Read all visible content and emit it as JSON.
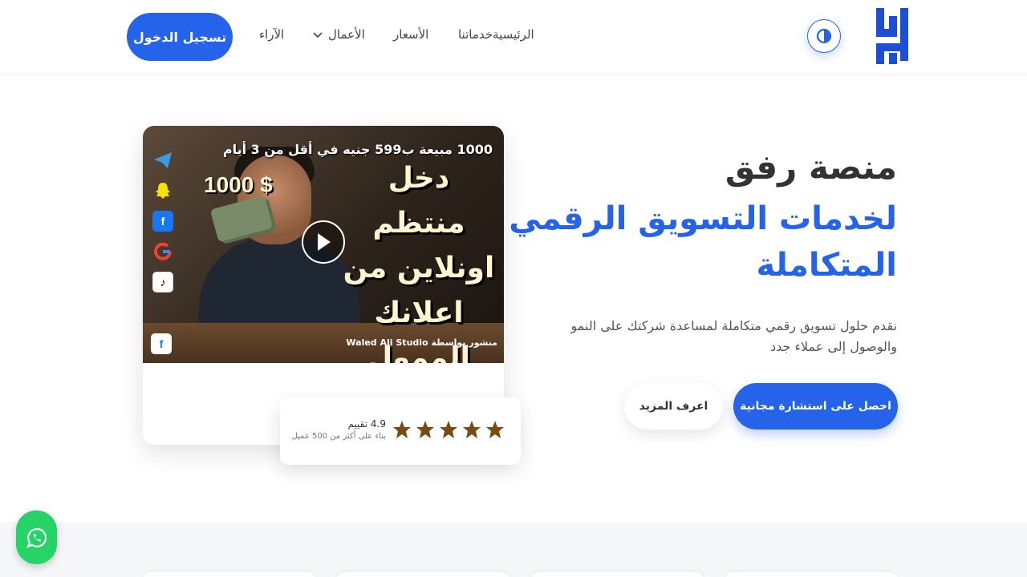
{
  "header": {
    "nav": {
      "home": "الرئيسية",
      "services": "خدماتنا",
      "pricing": "الأسعار",
      "works": "الأعمال",
      "reviews": "الآراء"
    },
    "login_label": "تسجيل الدخول"
  },
  "hero": {
    "title": "منصة رفق",
    "subtitle": "لخدمات التسويق الرقمي المتكاملة",
    "description": "نقدم حلول تسويق رقمي متكاملة لمساعدة شركتك على النمو والوصول إلى عملاء جدد",
    "primary_cta": "احصل على استشارة مجانية",
    "secondary_cta": "اعرف المزيد"
  },
  "video": {
    "top_line": "1000 مبيعة ب599 جنيه في أقل من 3 أيام",
    "money": "$ 1000",
    "big_text": "دخل منتظم اونلاين من اعلانك الممول",
    "credit": "منشور بواسطة Waled Ali Studio"
  },
  "rating": {
    "value": "4.9 تقييم",
    "note": "بناء على أكثر من 500 عميل",
    "stars": 5
  },
  "colors": {
    "accent": "#2563eb",
    "star": "#7a4a12",
    "whatsapp": "#25d366"
  },
  "icons": {
    "theme": "contrast-icon",
    "chevron": "chevron-down-icon",
    "play": "play-icon",
    "whatsapp": "whatsapp-icon"
  }
}
